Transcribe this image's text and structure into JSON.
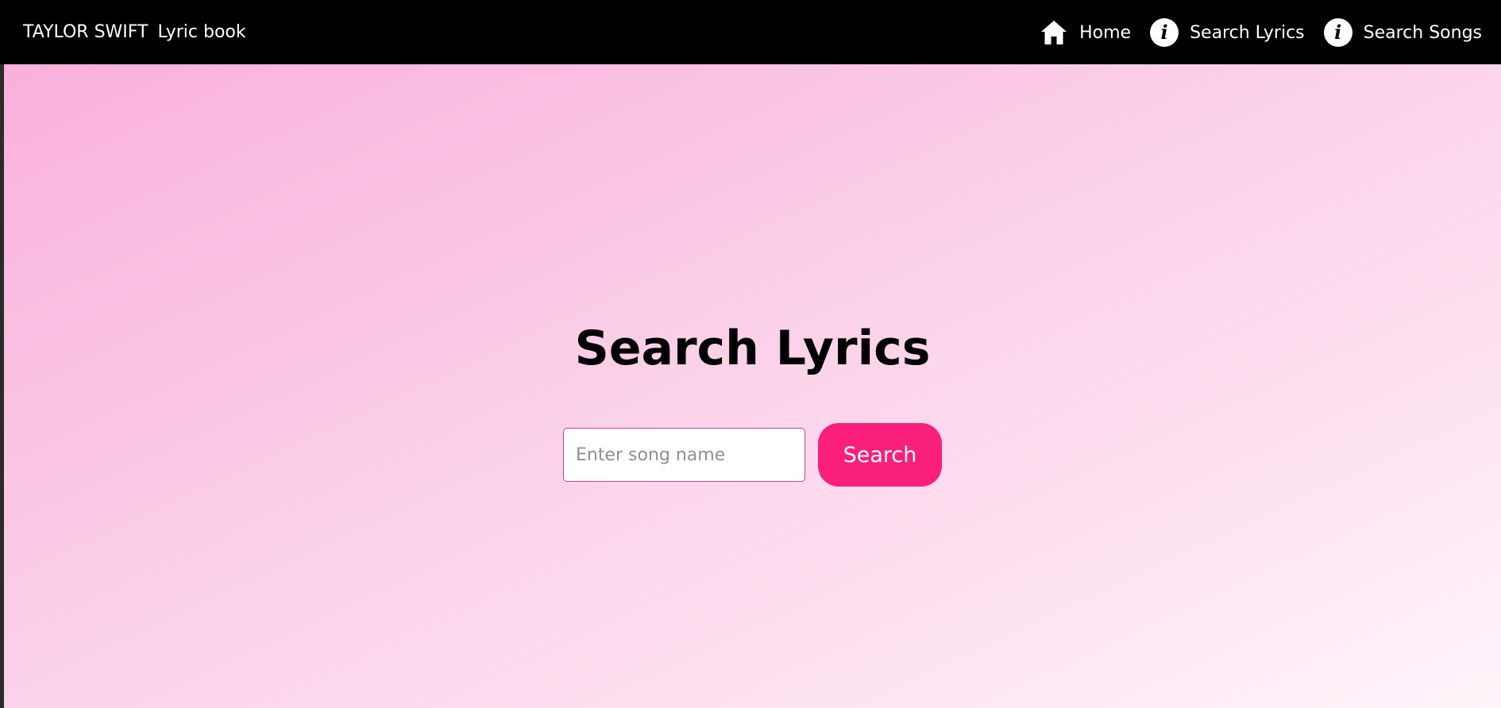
{
  "navbar": {
    "brand_title": "TAYLOR SWIFT",
    "brand_subtitle": "Lyric book",
    "links": [
      {
        "label": "Home",
        "icon": "home-icon"
      },
      {
        "label": "Search Lyrics",
        "icon": "info-icon"
      },
      {
        "label": "Search Songs",
        "icon": "info-icon"
      }
    ]
  },
  "main": {
    "heading": "Search Lyrics",
    "search": {
      "placeholder": "Enter song name",
      "value": "",
      "button_label": "Search"
    }
  },
  "colors": {
    "navbar_bg": "#000000",
    "accent": "#fb1f7c",
    "gradient_start": "#f9b0dc",
    "gradient_end": "#fff5fb",
    "input_border": "#c8458e"
  }
}
